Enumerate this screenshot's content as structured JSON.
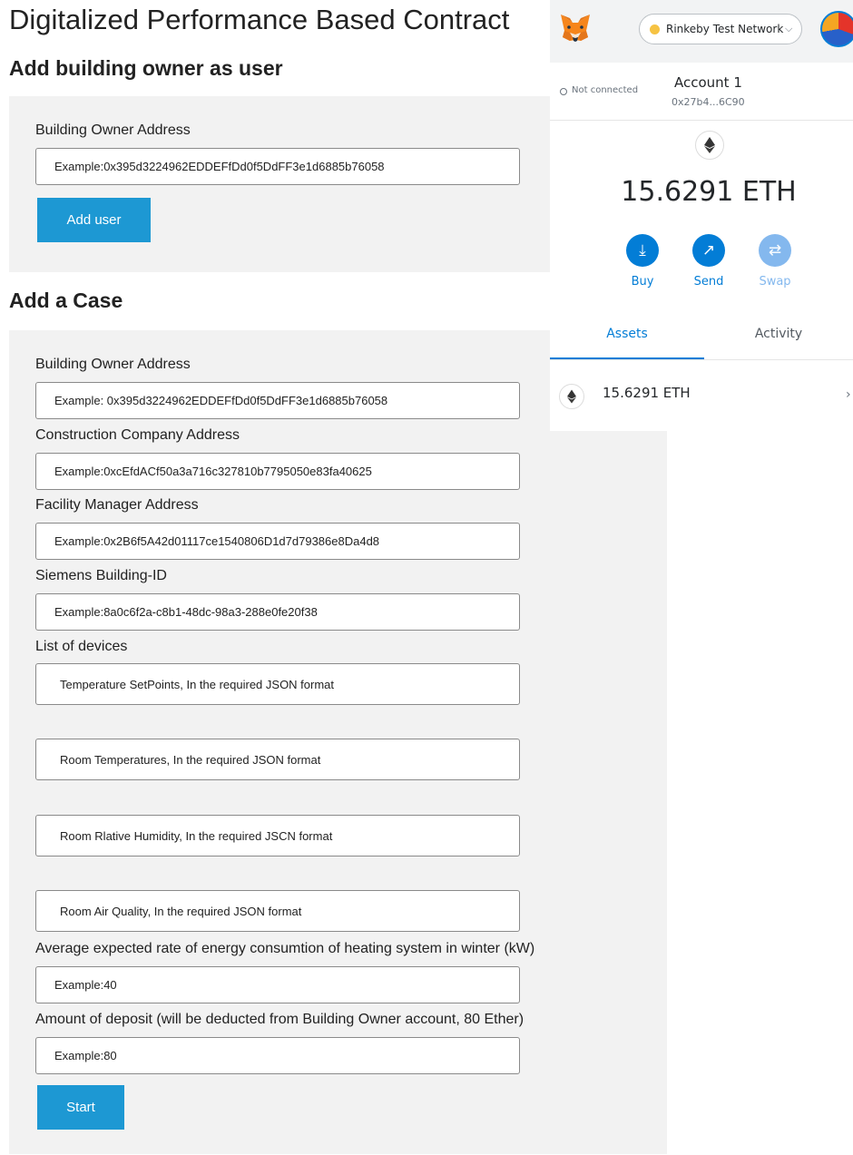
{
  "app": {
    "title": "Digitalized Performance Based Contract"
  },
  "add_user": {
    "heading": "Add building owner as user",
    "owner_label": "Building Owner Address",
    "owner_placeholder": "Example:0x395d3224962EDDEFfDd0f5DdFF3e1d6885b76058",
    "button": "Add user"
  },
  "add_case": {
    "heading": "Add a Case",
    "owner_label": "Building Owner Address",
    "owner_placeholder": "Example: 0x395d3224962EDDEFfDd0f5DdFF3e1d6885b76058",
    "construction_label": "Construction Company Address",
    "construction_placeholder": "Example:0xcEfdACf50a3a716c327810b7795050e83fa40625",
    "facility_label": "Facility Manager Address",
    "facility_placeholder": "Example:0x2B6f5A42d01117ce1540806D1d7d79386e8Da4d8",
    "building_id_label": "Siemens Building-ID",
    "building_id_placeholder": "Example:8a0c6f2a-c8b1-48dc-98a3-288e0fe20f38",
    "devices_label": "List of devices",
    "devices": [
      "Temperature SetPoints, In the required JSON format",
      "Room Temperatures, In the required JSON format",
      "Room Rlative Humidity, In the required JSCN format",
      "Room Air Quality, In the required JSON format"
    ],
    "energy_label": "Average expected rate of energy consumtion of heating system in winter (kW)",
    "energy_placeholder": "Example:40",
    "deposit_label": "Amount of deposit (will be deducted from Building Owner account, 80 Ether)",
    "deposit_placeholder": "Example:80",
    "button": "Start"
  },
  "wallet": {
    "network": "Rinkeby Test Network",
    "network_dot_color": "#f6c343",
    "connection_status": "Not connected",
    "account_name": "Account 1",
    "account_address": "0x27b4...6C90",
    "balance": "15.6291 ETH",
    "actions": {
      "buy": "Buy",
      "send": "Send",
      "swap": "Swap"
    },
    "tabs": {
      "assets": "Assets",
      "activity": "Activity"
    },
    "assets": [
      {
        "amount": "15.6291 ETH"
      }
    ],
    "accent_color": "#037dd6"
  }
}
